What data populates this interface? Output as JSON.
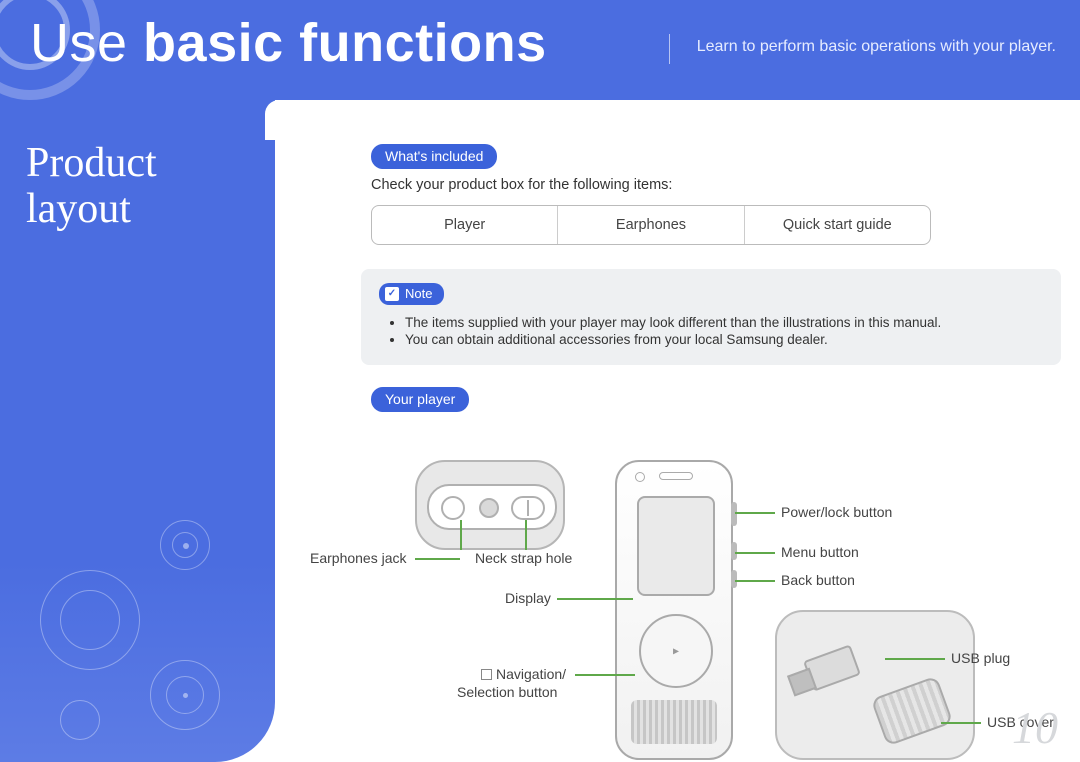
{
  "header": {
    "title_light": "Use ",
    "title_bold": "basic functions",
    "subtitle": "Learn to perform basic operations with your player."
  },
  "sidebar": {
    "section_line1": "Product",
    "section_line2": "layout"
  },
  "included": {
    "pill": "What's included",
    "intro": "Check your product box for the following items:",
    "items": [
      "Player",
      "Earphones",
      "Quick start guide"
    ]
  },
  "note": {
    "label": "Note",
    "bullets": [
      "The items supplied with your player may look different than the illustrations in this manual.",
      "You can obtain additional accessories from your local Samsung dealer."
    ]
  },
  "your_player": {
    "pill": "Your player",
    "labels": {
      "earphones_jack": "Earphones jack",
      "neck_strap_hole": "Neck strap hole",
      "display": "Display",
      "navigation": "Navigation/",
      "selection_button": "Selection button",
      "power_lock": "Power/lock button",
      "menu_button": "Menu button",
      "back_button": "Back button",
      "usb_plug": "USB plug",
      "usb_cover": "USB cover"
    }
  },
  "page_number": "10"
}
